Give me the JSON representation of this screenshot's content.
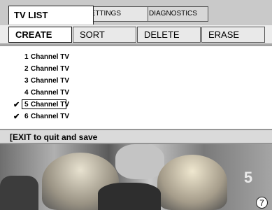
{
  "tabs": [
    {
      "label": "TV LIST",
      "active": true
    },
    {
      "label": "SETTINGS",
      "active": false
    },
    {
      "label": "DIAGNOSTICS",
      "active": false
    }
  ],
  "actions": [
    {
      "label": "CREATE",
      "active": true
    },
    {
      "label": "SORT",
      "active": false
    },
    {
      "label": "DELETE",
      "active": false
    },
    {
      "label": "ERASE",
      "active": false
    }
  ],
  "channels": [
    {
      "number": "1",
      "name": "Channel TV",
      "checked": false,
      "selected": false
    },
    {
      "number": "2",
      "name": "Channel TV",
      "checked": false,
      "selected": false
    },
    {
      "number": "3",
      "name": "Channel TV",
      "checked": false,
      "selected": false
    },
    {
      "number": "4",
      "name": "Channel TV",
      "checked": false,
      "selected": false
    },
    {
      "number": "5",
      "name": "Channel TV",
      "checked": true,
      "selected": true
    },
    {
      "number": "6",
      "name": "Channel TV",
      "checked": true,
      "selected": false
    }
  ],
  "check_glyph": "✔",
  "help_text": "[EXIT to quit and save",
  "page_badge": "7",
  "logo_text": "5"
}
